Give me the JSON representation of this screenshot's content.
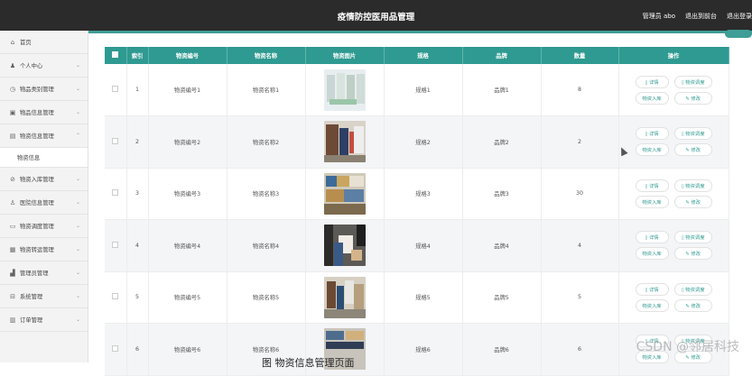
{
  "header": {
    "title": "疫情防控医用品管理",
    "admin_label": "管理员 abo",
    "back_link": "退出到前台",
    "logout_link": "退出登录"
  },
  "sidebar": {
    "items": [
      {
        "label": "首页",
        "icon": "home-icon",
        "glyph": "⌂",
        "arrow": ""
      },
      {
        "label": "个人中心",
        "icon": "user-icon",
        "glyph": "♟",
        "arrow": "⌄"
      },
      {
        "label": "物品类别管理",
        "icon": "clock-icon",
        "glyph": "◷",
        "arrow": "⌄"
      },
      {
        "label": "物品信息管理",
        "icon": "box-icon",
        "glyph": "▣",
        "arrow": "⌄"
      },
      {
        "label": "物资信息管理",
        "icon": "chat-icon",
        "glyph": "▤",
        "arrow": "⌃"
      },
      {
        "label": "物资信息",
        "icon": "",
        "glyph": "",
        "arrow": ""
      },
      {
        "label": "物资入库管理",
        "icon": "inbox-icon",
        "glyph": "⊘",
        "arrow": "⌄"
      },
      {
        "label": "医院信息管理",
        "icon": "person-icon",
        "glyph": "♙",
        "arrow": "⌄"
      },
      {
        "label": "物资调度管理",
        "icon": "message-icon",
        "glyph": "▭",
        "arrow": "⌄"
      },
      {
        "label": "物资转运管理",
        "icon": "grid-icon",
        "glyph": "▦",
        "arrow": "⌄"
      },
      {
        "label": "管理员管理",
        "icon": "chart-icon",
        "glyph": "▟",
        "arrow": "⌄"
      },
      {
        "label": "系统管理",
        "icon": "server-icon",
        "glyph": "⊟",
        "arrow": "⌄"
      },
      {
        "label": "订单管理",
        "icon": "order-icon",
        "glyph": "▥",
        "arrow": "⌄"
      }
    ]
  },
  "table": {
    "headers": [
      "索引",
      "物资编号",
      "物资名称",
      "物资图片",
      "规格",
      "品牌",
      "数量",
      "操作"
    ],
    "buttons": {
      "detail": "▯ 详情",
      "dispatch": "▯ 物资调度",
      "stock_in": "物资入库",
      "edit": "✎ 修改"
    },
    "rows": [
      {
        "index": "1",
        "code": "物资编号1",
        "name": "物资名称1",
        "spec": "规格1",
        "brand": "品牌1",
        "qty": "8"
      },
      {
        "index": "2",
        "code": "物资编号2",
        "name": "物资名称2",
        "spec": "规格2",
        "brand": "品牌2",
        "qty": "2"
      },
      {
        "index": "3",
        "code": "物资编号3",
        "name": "物资名称3",
        "spec": "规格3",
        "brand": "品牌3",
        "qty": "30"
      },
      {
        "index": "4",
        "code": "物资编号4",
        "name": "物资名称4",
        "spec": "规格4",
        "brand": "品牌4",
        "qty": "4"
      },
      {
        "index": "5",
        "code": "物资编号5",
        "name": "物资名称5",
        "spec": "规格5",
        "brand": "品牌5",
        "qty": "5"
      },
      {
        "index": "6",
        "code": "物资编号6",
        "name": "物资名称6",
        "spec": "规格6",
        "brand": "品牌6",
        "qty": "6"
      }
    ]
  },
  "watermark": "CSDN @邻居科技",
  "caption": "图  物资信息管理页面",
  "colors": {
    "accent": "#2f9a91",
    "topbar": "#2b2b2b"
  }
}
